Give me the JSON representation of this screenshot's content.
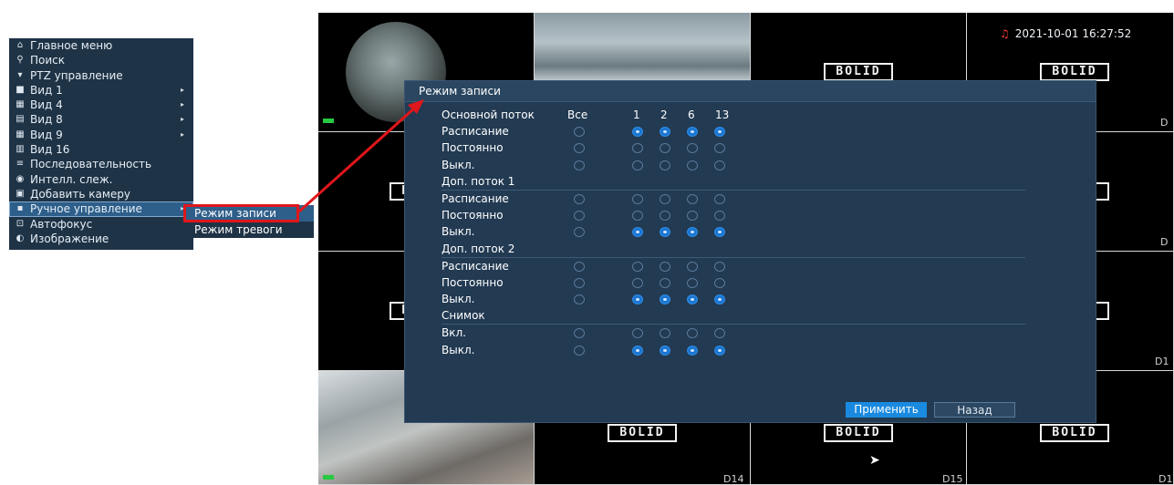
{
  "menu": {
    "items": [
      {
        "icon": "home-icon",
        "glyph": "⌂",
        "label": "Главное меню",
        "arrow": false
      },
      {
        "icon": "search-icon",
        "glyph": "⚲",
        "label": "Поиск",
        "arrow": false
      },
      {
        "icon": "ptz-icon",
        "glyph": "▾",
        "label": "PTZ управление",
        "arrow": false
      },
      {
        "icon": "view1-icon",
        "glyph": "■",
        "label": "Вид 1",
        "arrow": true
      },
      {
        "icon": "view4-icon",
        "glyph": "▦",
        "label": "Вид 4",
        "arrow": true
      },
      {
        "icon": "view8-icon",
        "glyph": "▤",
        "label": "Вид 8",
        "arrow": true
      },
      {
        "icon": "view9-icon",
        "glyph": "▦",
        "label": "Вид 9",
        "arrow": true
      },
      {
        "icon": "view16-icon",
        "glyph": "▥",
        "label": "Вид 16",
        "arrow": false
      },
      {
        "icon": "sequence-icon",
        "glyph": "≡",
        "label": "Последовательность",
        "arrow": false
      },
      {
        "icon": "intelligent-tracking-icon",
        "glyph": "◉",
        "label": "Интелл. слеж.",
        "arrow": false
      },
      {
        "icon": "add-camera-icon",
        "glyph": "▣",
        "label": "Добавить камеру",
        "arrow": false
      },
      {
        "icon": "manual-control-icon",
        "glyph": "▪",
        "label": "Ручное управление",
        "arrow": true,
        "highlight": true
      },
      {
        "icon": "autofocus-icon",
        "glyph": "⊡",
        "label": "Автофокус",
        "arrow": false
      },
      {
        "icon": "image-icon",
        "glyph": "◐",
        "label": "Изображение",
        "arrow": false
      }
    ],
    "submenu": [
      {
        "label": "Режим записи",
        "highlight": true
      },
      {
        "label": "Режим тревоги",
        "highlight": false
      }
    ]
  },
  "grid": {
    "datetime": "2021-10-01 16:27:52",
    "logo_text": "BOLID",
    "labels": [
      "D14",
      "D15",
      "D1",
      "D",
      "D",
      "D1",
      "D"
    ]
  },
  "dialog": {
    "title": "Режим записи",
    "columns": [
      "Все",
      "1",
      "2",
      "6",
      "13"
    ],
    "rows": [
      {
        "type": "header",
        "label": "Основной поток"
      },
      {
        "type": "option",
        "label": "Расписание",
        "all": false,
        "ch": [
          true,
          true,
          true,
          true
        ]
      },
      {
        "type": "option",
        "label": "Постоянно",
        "all": false,
        "ch": [
          false,
          false,
          false,
          false
        ]
      },
      {
        "type": "option",
        "label": "Выкл.",
        "all": false,
        "ch": [
          false,
          false,
          false,
          false
        ]
      },
      {
        "type": "section",
        "label": "Доп. поток 1"
      },
      {
        "type": "option",
        "label": "Расписание",
        "all": false,
        "ch": [
          false,
          false,
          false,
          false
        ]
      },
      {
        "type": "option",
        "label": "Постоянно",
        "all": false,
        "ch": [
          false,
          false,
          false,
          false
        ]
      },
      {
        "type": "option",
        "label": "Выкл.",
        "all": false,
        "ch": [
          true,
          true,
          true,
          true
        ]
      },
      {
        "type": "section",
        "label": "Доп. поток 2"
      },
      {
        "type": "option",
        "label": "Расписание",
        "all": false,
        "ch": [
          false,
          false,
          false,
          false
        ]
      },
      {
        "type": "option",
        "label": "Постоянно",
        "all": false,
        "ch": [
          false,
          false,
          false,
          false
        ]
      },
      {
        "type": "option",
        "label": "Выкл.",
        "all": false,
        "ch": [
          true,
          true,
          true,
          true
        ]
      },
      {
        "type": "section",
        "label": "Снимок"
      },
      {
        "type": "option",
        "label": "Вкл.",
        "all": false,
        "ch": [
          false,
          false,
          false,
          false
        ]
      },
      {
        "type": "option",
        "label": "Выкл.",
        "all": false,
        "ch": [
          true,
          true,
          true,
          true
        ]
      }
    ],
    "apply_label": "Применить",
    "back_label": "Назад"
  },
  "colors": {
    "accent": "#1a8ae0",
    "annotation": "#e0161b",
    "panel": "#223a52"
  }
}
